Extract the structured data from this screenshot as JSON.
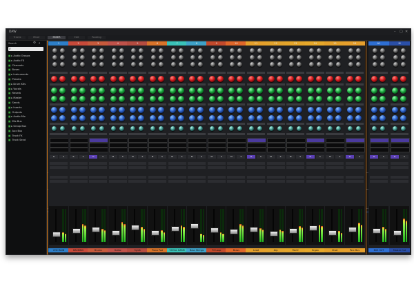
{
  "window": {
    "title": "DAW",
    "controls": [
      "–",
      "▢",
      "✕"
    ]
  },
  "tabs": [
    {
      "label": "Tracks",
      "active": false
    },
    {
      "label": "Mixer",
      "active": false
    },
    {
      "label": "MIXER",
      "active": true
    },
    {
      "label": "Edit",
      "active": false
    },
    {
      "label": "Routing",
      "active": false
    }
  ],
  "browser": {
    "header": "Search",
    "search_placeholder": "",
    "tree": [
      "▸ Audio Groups",
      "▸ Audio FX",
      "  Channels",
      "  Buses",
      "▸ Instruments",
      "  Presets",
      "▸ Drum Kits",
      "▸ Vocals",
      "  Reverb",
      "▸ Master",
      "  Sends",
      "▸ Inserts",
      "  Outputs",
      "▸ Audio Mix",
      "  Mix Bus",
      "▸ Group Bus",
      "  Aux Bus",
      "  Track FX",
      "  Track Send"
    ]
  },
  "colors": {
    "accent_orange": "#d27a1d",
    "knob_red": "#d4181c",
    "knob_green": "#17a63c",
    "knob_blue": "#2b5fc8",
    "insert_purple": "#5a3fb4",
    "meter_green": "#1db51d"
  },
  "strips": [
    {
      "id": "1",
      "name": "VOX MAIN",
      "color": "#2d7fc9",
      "insert": false,
      "chip_a": "R",
      "chip_b": "S",
      "level": 0.3,
      "fader": 0.25
    },
    {
      "id": "2",
      "name": "BACKING",
      "color": "#c74a3a",
      "insert": false,
      "chip_a": "R",
      "chip_b": "S",
      "level": 0.55,
      "fader": 0.35
    },
    {
      "id": "3",
      "name": "Drums",
      "color": "#c75a3c",
      "insert": true,
      "chip_a": "M",
      "chip_b": "S",
      "level": 0.4,
      "fader": 0.4
    },
    {
      "id": "4",
      "name": "Guitar",
      "color": "#c0524a",
      "insert": false,
      "chip_a": "M",
      "chip_b": "S",
      "level": 0.6,
      "fader": 0.3
    },
    {
      "id": "5",
      "name": "Synth",
      "color": "#b54c40",
      "insert": false,
      "chip_a": "M",
      "chip_b": "S",
      "level": 0.45,
      "fader": 0.45
    },
    {
      "id": "6",
      "name": "Piano Pad",
      "color": "#d9742a",
      "insert": false,
      "chip_a": "M",
      "chip_b": "S",
      "level": 0.35,
      "fader": 0.3
    },
    {
      "id": "7",
      "name": "VOCAL HARM",
      "color": "#3ac2b8",
      "insert": false,
      "chip_a": "M",
      "chip_b": "S",
      "level": 0.5,
      "fader": 0.42
    },
    {
      "id": "8",
      "name": "Bass Strings",
      "color": "#3fa2c8",
      "insert": false,
      "chip_a": "M",
      "chip_b": "S",
      "level": 0.25,
      "fader": 0.5
    },
    {
      "id": "9",
      "name": "FX Loop",
      "color": "#c34a2c",
      "insert": false,
      "chip_a": "M",
      "chip_b": "S",
      "level": 0.3,
      "fader": 0.38
    },
    {
      "id": "10",
      "name": "Brass",
      "color": "#e0672a",
      "insert": false,
      "chip_a": "M",
      "chip_b": "S",
      "level": 0.55,
      "fader": 0.33
    },
    {
      "id": "11",
      "name": "Lead",
      "color": "#e5a02b",
      "insert": true,
      "chip_a": "M",
      "chip_b": "S",
      "level": 0.42,
      "fader": 0.4
    },
    {
      "id": "12",
      "name": "Arp",
      "color": "#e2a32c",
      "insert": false,
      "chip_a": "M",
      "chip_b": "S",
      "level": 0.38,
      "fader": 0.28
    },
    {
      "id": "13",
      "name": "Pad 2",
      "color": "#e4a52a",
      "insert": false,
      "chip_a": "M",
      "chip_b": "S",
      "level": 0.48,
      "fader": 0.36
    },
    {
      "id": "14",
      "name": "Organ",
      "color": "#e6a82a",
      "insert": true,
      "chip_a": "M",
      "chip_b": "S",
      "level": 0.52,
      "fader": 0.44
    },
    {
      "id": "15",
      "name": "Choir",
      "color": "#e3a02a",
      "insert": false,
      "chip_a": "M",
      "chip_b": "S",
      "level": 0.33,
      "fader": 0.3
    },
    {
      "id": "16",
      "name": "Perc Bus",
      "color": "#e69f2c",
      "insert": true,
      "chip_a": "M",
      "chip_b": "S",
      "level": 0.58,
      "fader": 0.4
    }
  ],
  "master_strips": [
    {
      "id": "A1",
      "name": "BUS OUT",
      "color": "#2e6fd3",
      "insert": true,
      "chip_a": "M",
      "chip_b": "S",
      "level": 0.45,
      "fader": 0.35
    },
    {
      "id": "M",
      "name": "Master Out",
      "color": "#2a4fa8",
      "insert": true,
      "chip_a": "M",
      "chip_b": "S",
      "level": 0.7,
      "fader": 0.3
    }
  ]
}
